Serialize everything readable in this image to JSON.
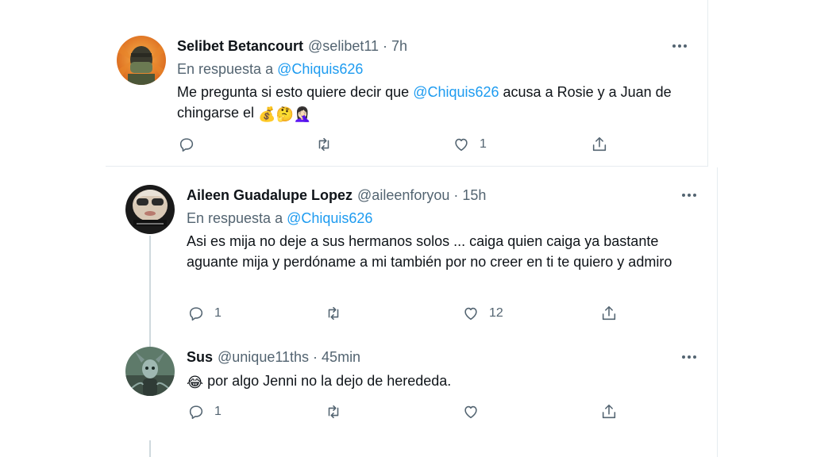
{
  "tweets": [
    {
      "name": "Selibet Betancourt",
      "handle": "@selibet11",
      "time": "7h",
      "reply_prefix": "En respuesta a",
      "reply_handle": "@Chiquis626",
      "text_parts": [
        "Me pregunta si esto quiere decir que ",
        "@Chiquis626",
        " acusa a Rosie y a Juan de chingarse el "
      ],
      "emojis": [
        "💰",
        "🤔",
        "🤦🏻‍♀️"
      ],
      "reply_count": "",
      "like_count": "1"
    },
    {
      "name": "Aileen Guadalupe Lopez",
      "handle": "@aileenforyou",
      "time": "15h",
      "reply_prefix": "En respuesta a",
      "reply_handle": "@Chiquis626",
      "text": "Asi es mija no deje a sus hermanos solos ... caiga quien caiga ya bastante aguante mija y perdóname a mi también por no creer en ti te quiero y admiro",
      "reply_count": "1",
      "like_count": "12"
    },
    {
      "name": "Sus",
      "handle": "@unique11ths",
      "time": "45min",
      "emoji": "😂",
      "text": "por algo Jenni no la dejo de herededa.",
      "reply_count": "1",
      "like_count": ""
    }
  ],
  "separator": "·",
  "colors": {
    "link": "#1d9bf0",
    "secondary_text": "#536471",
    "border": "#e6ecf0",
    "thread_line": "#cfd9de"
  }
}
